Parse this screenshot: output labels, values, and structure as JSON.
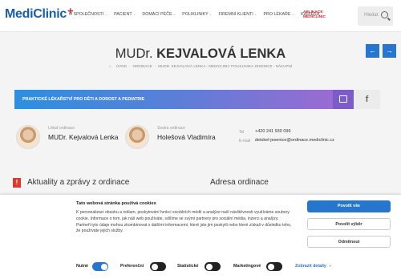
{
  "header": {
    "logo_text": "MediClinic",
    "logo_plus": "+",
    "nav": [
      "O SPOLEČNOSTI",
      "PACIENT",
      "DOMÁCÍ PÉČE",
      "POLIKLINIKY",
      "FIREMNÍ KLIENTI",
      "PRO LÉKAŘE",
      "KARIÉRA"
    ],
    "nav_chevron": "⌄",
    "app_line1": "APLIKACE",
    "app_line2": "MEDICLINIC",
    "search_placeholder": "Hledat"
  },
  "title": {
    "prefix": "MUDr.",
    "name": "KEJVALOVÁ LENKA",
    "breadcrumbs": [
      "ÚVOD",
      "ORDINACE",
      "MUDR. KEJVALOVÁ LENKA - MEDICLINIC POLIKLINIKA JESENICE - NÁKUPNÍ"
    ],
    "breadcrumb_home_icon": "⌂",
    "prev_arrow": "←",
    "next_arrow": "→"
  },
  "specialty_bar": {
    "text": "PRAKTICKÉ LÉKAŘSTVÍ PRO DĚTI A DOROST A PEDIATRIE",
    "fb_label": "f"
  },
  "staff": [
    {
      "role": "Lékař ordinace",
      "name": "MUDr. Kejvalová Lenka"
    },
    {
      "role": "Sestra ordinace",
      "name": "Holešová Vladimíra"
    }
  ],
  "contact": {
    "tel_label": "Tel",
    "tel": "+420 241 930 096",
    "email_label": "E-mail",
    "email": "detskel-jesenice@ordinace.mediclinic.cz"
  },
  "sections": {
    "news_icon": "!",
    "news": "Aktuality a zprávy z ordinace",
    "address": "Adresa ordinace"
  },
  "cookie": {
    "title": "Tato webová stránka používá cookies",
    "body": "K personalizaci obsahu a reklam, poskytování funkcí sociálních médií a analýze naší návštěvnosti využíváme soubory cookie. Informace o tom, jak náš web používáte, sdílíme se svými partnery pro sociální média, inzerci a analýzy. Partneři tyto údaje mohou zkombinovat s dalšími informacemi, které jste jim poskytli nebo které získali v důsledku toho, že používáte jejich služby.",
    "buttons": [
      "Povolit vše",
      "Povolit výběr",
      "Odmítnout"
    ],
    "toggles": [
      {
        "label": "Nutné",
        "on": true
      },
      {
        "label": "Preferenční",
        "on": false
      },
      {
        "label": "Statistické",
        "on": false
      },
      {
        "label": "Marketingové",
        "on": false
      }
    ],
    "details": "Zobrazit detaily",
    "details_chevron": "›"
  },
  "colors": {
    "brand_blue": "#1a5ea8",
    "accent_red": "#d91f26",
    "button_blue": "#2676d0"
  }
}
